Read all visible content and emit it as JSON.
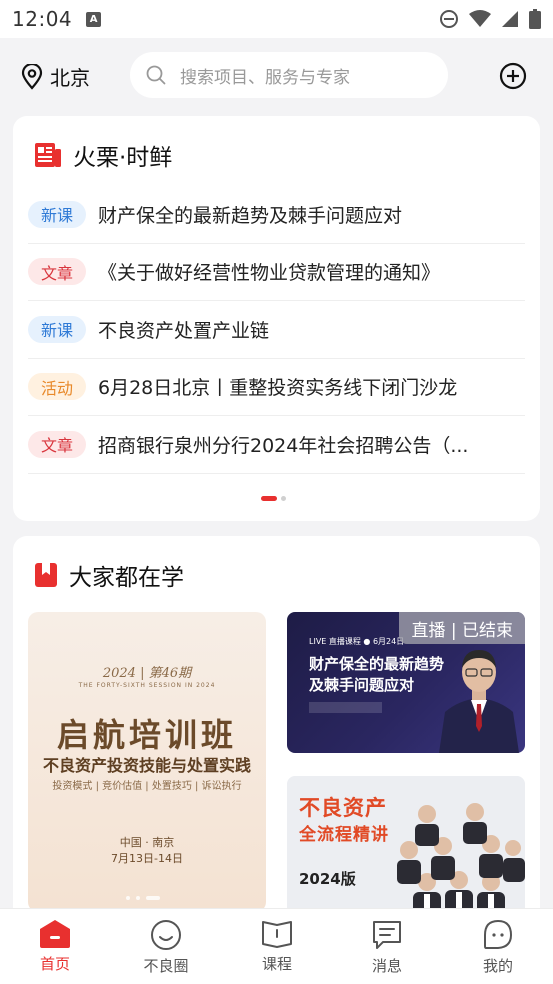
{
  "status_bar": {
    "time": "12:04",
    "notif_icon": "A"
  },
  "header": {
    "location": "北京",
    "search_placeholder": "搜索项目、服务与专家"
  },
  "hot": {
    "title": "火栗·时鲜",
    "items": [
      {
        "tag": "新课",
        "tag_color": "blue",
        "text": "财产保全的最新趋势及棘手问题应对"
      },
      {
        "tag": "文章",
        "tag_color": "red",
        "text": "《关于做好经营性物业贷款管理的通知》"
      },
      {
        "tag": "新课",
        "tag_color": "blue",
        "text": "不良资产处置产业链"
      },
      {
        "tag": "活动",
        "tag_color": "orange",
        "text": "6月28日北京丨重整投资实务线下闭门沙龙"
      },
      {
        "tag": "文章",
        "tag_color": "red",
        "text": "招商银行泉州分行2024年社会招聘公告（..."
      }
    ]
  },
  "learning": {
    "title": "大家都在学",
    "banner": {
      "year": "2024",
      "issue": "第46期",
      "sub": "THE FORTY-SIXTH SESSION IN 2024",
      "title": "启航培训班",
      "subtitle": "不良资产投资技能与处置实践",
      "tags": "投资模式 | 竞价估值 | 处置技巧 | 诉讼执行",
      "place": "中国 · 南京",
      "date": "7月13日-14日"
    },
    "live": {
      "badge": "直播 | 已结束",
      "top": "LIVE 直播课程  ● 6月24日",
      "title_line1": "财产保全的最新趋势",
      "title_line2": "及棘手问题应对"
    },
    "course": {
      "title1": "不良资产",
      "title2": "全流程精讲",
      "year": "2024版"
    }
  },
  "tabs": [
    {
      "label": "首页",
      "active": true
    },
    {
      "label": "不良圈",
      "active": false
    },
    {
      "label": "课程",
      "active": false
    },
    {
      "label": "消息",
      "active": false
    },
    {
      "label": "我的",
      "active": false
    }
  ],
  "colors": {
    "accent": "#e8302f",
    "tag_blue": "#2f7ad6",
    "tag_red": "#d9363e",
    "tag_orange": "#e8892a"
  }
}
